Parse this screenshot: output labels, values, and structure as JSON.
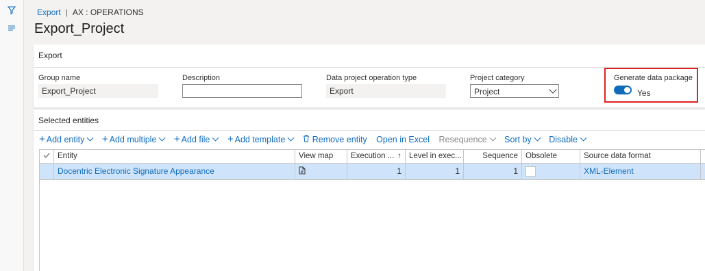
{
  "nav": {
    "filter_icon": "filter-icon",
    "menu_icon": "hamburger-icon"
  },
  "breadcrumb": {
    "link": "Export",
    "separator": "|",
    "context": "AX : OPERATIONS"
  },
  "page": {
    "title": "Export_Project"
  },
  "export_section": {
    "title": "Export",
    "group_name": {
      "label": "Group name",
      "value": "Export_Project"
    },
    "description": {
      "label": "Description",
      "value": ""
    },
    "operation_type": {
      "label": "Data project operation type",
      "value": "Export"
    },
    "project_category": {
      "label": "Project category",
      "value": "Project"
    },
    "generate_package": {
      "label": "Generate data package",
      "value": "Yes",
      "on": true
    }
  },
  "entities": {
    "title": "Selected entities",
    "toolbar": {
      "add_entity": "Add entity",
      "add_multiple": "Add multiple",
      "add_file": "Add file",
      "add_template": "Add template",
      "remove_entity": "Remove entity",
      "open_excel": "Open in Excel",
      "resequence": "Resequence",
      "sort_by": "Sort by",
      "disable": "Disable"
    },
    "columns": [
      "Entity",
      "View map",
      "Execution ...",
      "Level in exec...",
      "Sequence",
      "Obsolete",
      "Source data format"
    ],
    "rows": [
      {
        "entity": "Docentric Electronic Signature Appearance",
        "execution": "1",
        "level": "1",
        "sequence": "1",
        "format": "XML-Element"
      }
    ]
  },
  "colors": {
    "accent": "#0f6cbd",
    "highlight": "#e02020",
    "selected_row": "#cfe4fa"
  }
}
